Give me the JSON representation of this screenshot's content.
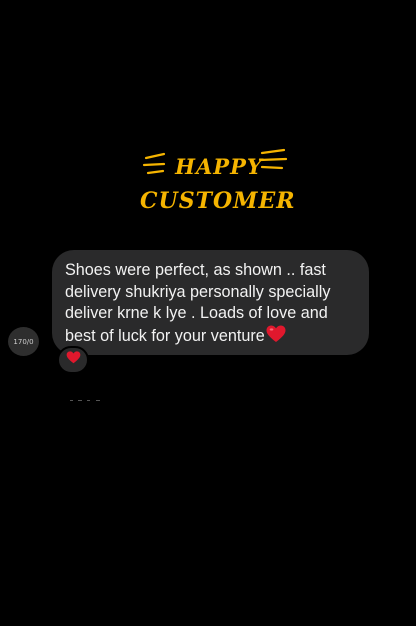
{
  "heading": {
    "line1": "HAPPY",
    "line2": "CUSTOMER",
    "color": "#f5b400"
  },
  "sender": {
    "avatar_label": "170/0"
  },
  "message": {
    "text": "Shoes were perfect, as shown .. fast\ndelivery shukriya personally specially\ndeliver krne k lye . Loads of love and\nbest of luck for your venture",
    "inline_emoji": "heart-icon",
    "bubble_color": "#2a2a2b",
    "text_color": "#f2f2f2"
  },
  "reaction": {
    "emoji": "heart-icon",
    "color": "#e0182d"
  }
}
